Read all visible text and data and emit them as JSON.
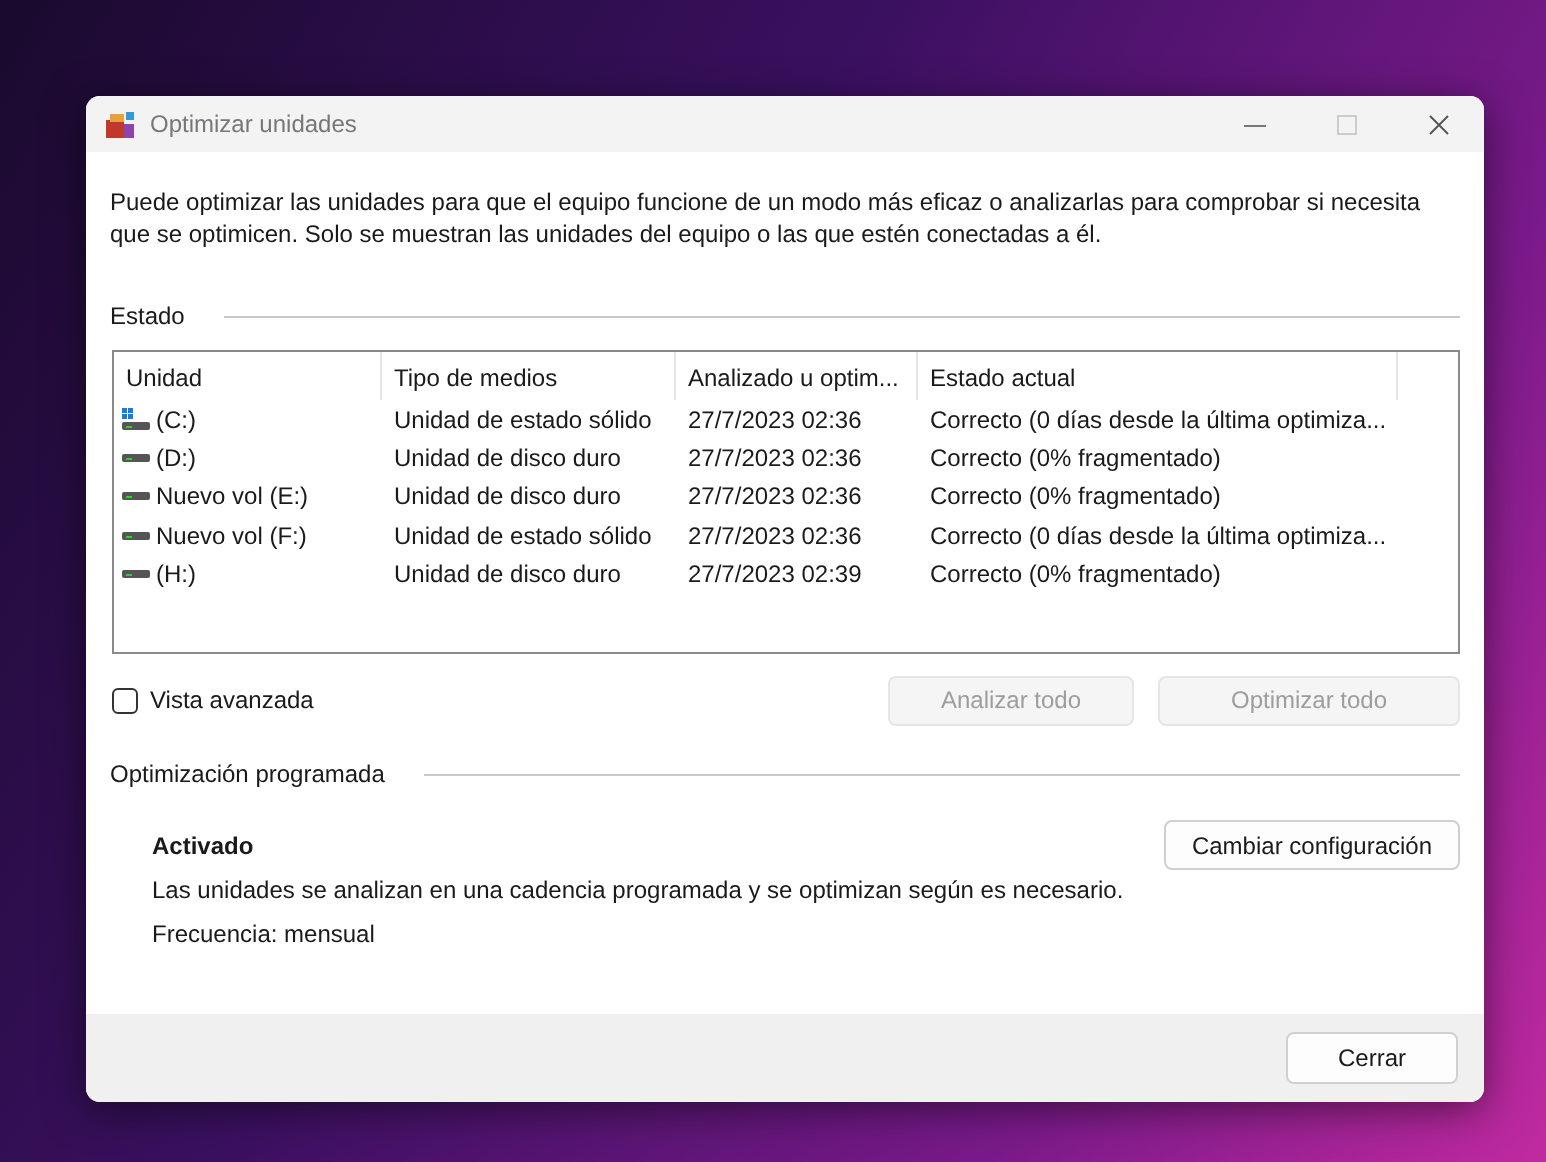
{
  "window": {
    "title": "Optimizar unidades"
  },
  "description": "Puede optimizar las unidades para que el equipo funcione de un modo más eficaz o analizarlas para comprobar si necesita que se optimicen. Solo se muestran las unidades del equipo o las que estén conectadas a él.",
  "status_section": {
    "heading": "Estado",
    "table": {
      "columns": [
        "Unidad",
        "Tipo de medios",
        "Analizado u optim...",
        "Estado actual"
      ],
      "rows": [
        {
          "kind": "system",
          "cells": [
            "(C:)",
            "Unidad de estado sólido",
            "27/7/2023 02:36",
            "Correcto (0 días desde la última optimiza..."
          ]
        },
        {
          "kind": "drive",
          "cells": [
            "(D:)",
            "Unidad de disco duro",
            "27/7/2023 02:36",
            "Correcto (0% fragmentado)"
          ]
        },
        {
          "kind": "drive",
          "cells": [
            "Nuevo vol (E:)",
            "Unidad de disco duro",
            "27/7/2023 02:36",
            "Correcto (0% fragmentado)"
          ]
        },
        {
          "kind": "drive",
          "cells": [
            "Nuevo vol (F:)",
            "Unidad de estado sólido",
            "27/7/2023 02:36",
            "Correcto (0 días desde la última optimiza..."
          ]
        },
        {
          "kind": "drive",
          "cells": [
            "(H:)",
            "Unidad de disco duro",
            "27/7/2023 02:39",
            "Correcto (0% fragmentado)"
          ]
        }
      ]
    },
    "advanced_view": {
      "label": "Vista avanzada",
      "checked": false
    },
    "buttons": [
      {
        "label": "Analizar todo",
        "disabled": true
      },
      {
        "label": "Optimizar todo",
        "disabled": true
      }
    ]
  },
  "scheduled_section": {
    "heading": "Optimización programada",
    "state": "Activado",
    "description": "Las unidades se analizan en una cadencia programada y se optimizan según es necesario.",
    "frequency": "Frecuencia: mensual",
    "button": {
      "label": "Cambiar configuración",
      "disabled": false
    }
  },
  "footer": {
    "button": {
      "label": "Cerrar",
      "disabled": false
    }
  }
}
